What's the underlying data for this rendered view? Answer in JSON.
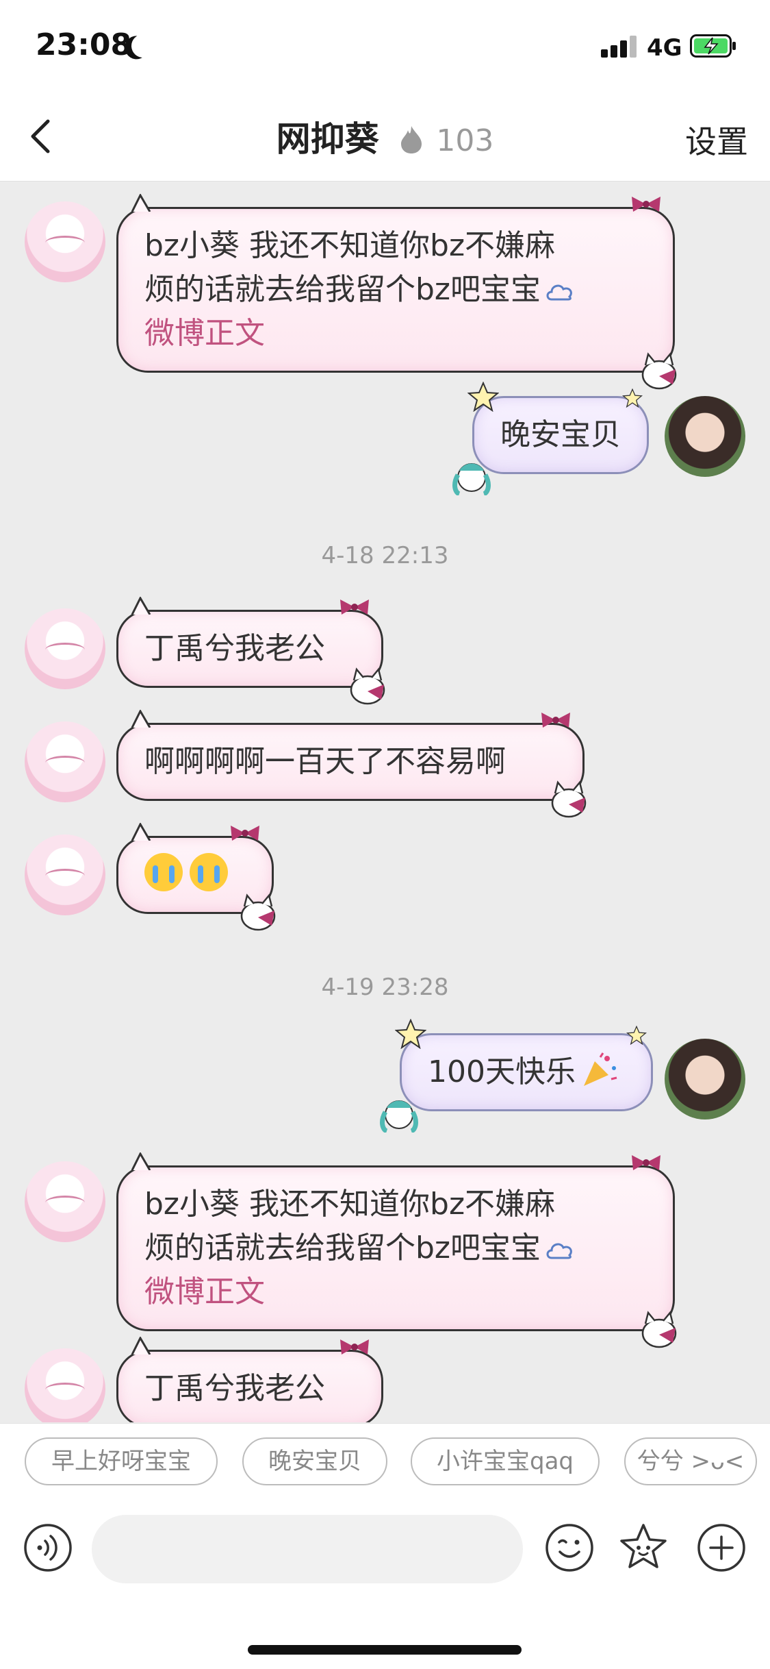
{
  "status_bar": {
    "time": "23:08",
    "network": "4G"
  },
  "header": {
    "title": "网抑葵",
    "count": "103",
    "settings_label": "设置"
  },
  "messages": [
    {
      "side": "left",
      "line1": "bz小葵 我还不知道你bz不嫌麻",
      "line2": "烦的话就去给我留个bz吧宝宝",
      "link": "微博正文"
    },
    {
      "side": "right",
      "text": "晚安宝贝"
    },
    {
      "timestamp": "4-18 22:13"
    },
    {
      "side": "left",
      "text": "丁禹兮我老公"
    },
    {
      "side": "left",
      "text": "啊啊啊啊一百天了不容易啊"
    },
    {
      "side": "left",
      "emoji": "crying-face ×2"
    },
    {
      "timestamp": "4-19 23:28"
    },
    {
      "side": "right",
      "text": "100天快乐"
    },
    {
      "side": "left",
      "line1": "bz小葵 我还不知道你bz不嫌麻",
      "line2": "烦的话就去给我留个bz吧宝宝",
      "link": "微博正文"
    },
    {
      "side": "left",
      "text": "丁禹兮我老公"
    }
  ],
  "quick_replies": [
    "早上好呀宝宝",
    "晚安宝贝",
    "小许宝宝qaq",
    "兮兮 >ᴗ<"
  ],
  "input": {
    "placeholder": ""
  },
  "colors": {
    "link": "#c0527f",
    "bubble_left": "#fde7f0",
    "bubble_right": "#eee6fb",
    "background": "#ececec"
  }
}
